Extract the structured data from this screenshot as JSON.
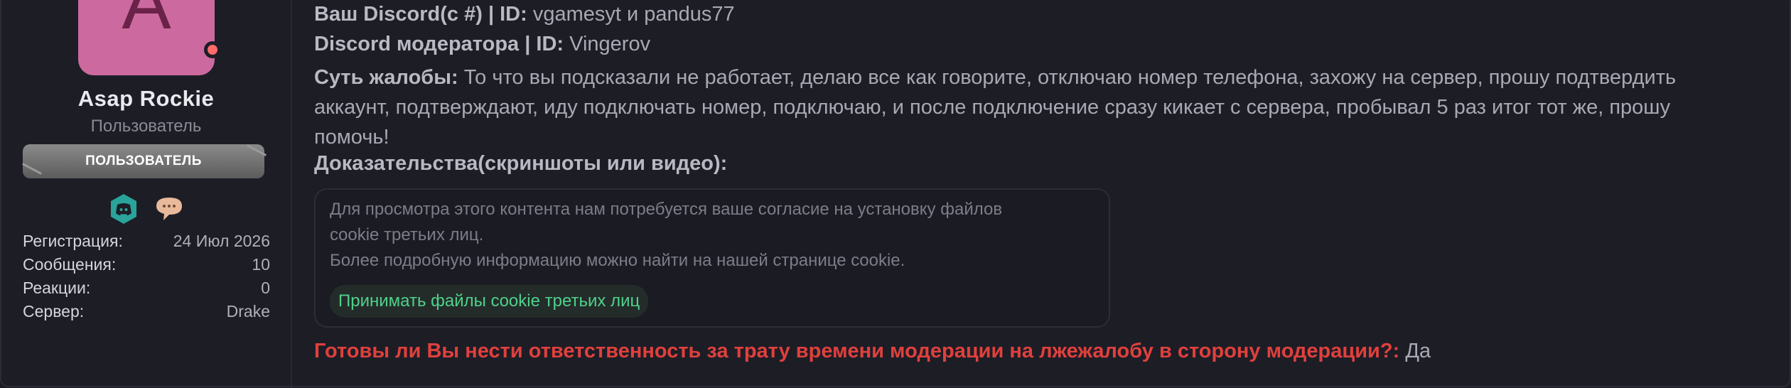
{
  "user": {
    "avatar_letter": "A",
    "avatar_color": "#cc6a9f",
    "username": "Asap Rockie",
    "title": "Пользователь",
    "banner": "ПОЛЬЗОВАТЕЛЬ",
    "icons": [
      "discord-icon",
      "chat-bubble-icon"
    ],
    "stats": [
      {
        "label": "Регистрация:",
        "value": "24 Июл 2026"
      },
      {
        "label": "Сообщения:",
        "value": "10"
      },
      {
        "label": "Реакции:",
        "value": "0"
      },
      {
        "label": "Сервер:",
        "value": "Drake"
      }
    ]
  },
  "post": {
    "your_discord_label": "Ваш Discord(с #) | ID:",
    "your_discord_value": "vgamesyt  и pandus77",
    "mod_discord_label": "Discord модератора | ID:",
    "mod_discord_value": "Vingerov",
    "complaint_label": "Суть жалобы:",
    "complaint_text": "То что вы подсказали не работает, делаю все как говорите, отключаю номер телефона, захожу на сервер, прошу подтвердить аккаунт, подтверждают, иду подключать номер, подключаю, и после подключение сразу кикает с сервера, пробывал 5 раз итог тот же, прошу помочь!",
    "evidence_label": "Доказательства(скриншоты или видео):",
    "cookie_notice": {
      "line1": "Для просмотра этого контента нам потребуется ваше согласие на установку файлов",
      "line2": "cookie третьих лиц.",
      "line3": "Более подробную информацию можно найти на нашей странице cookie.",
      "button": "Принимать файлы cookie третьих лиц"
    },
    "question_label": "Готовы ли Вы нести ответственность за трату времени модерации на лжежалобу в сторону модерации?:",
    "question_answer": "Да"
  },
  "colors": {
    "accent_red": "#e0403c",
    "accent_green": "#4fd18b",
    "discord_teal": "#2aa39a"
  }
}
